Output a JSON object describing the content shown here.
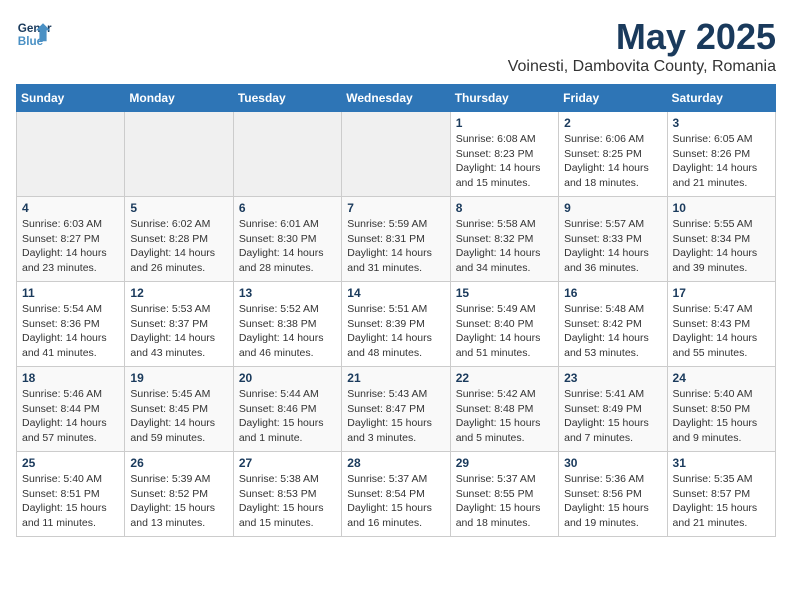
{
  "header": {
    "logo": {
      "line1": "General",
      "line2": "Blue"
    },
    "month_year": "May 2025",
    "location": "Voinesti, Dambovita County, Romania"
  },
  "weekdays": [
    "Sunday",
    "Monday",
    "Tuesday",
    "Wednesday",
    "Thursday",
    "Friday",
    "Saturday"
  ],
  "weeks": [
    [
      {
        "day": "",
        "info": ""
      },
      {
        "day": "",
        "info": ""
      },
      {
        "day": "",
        "info": ""
      },
      {
        "day": "",
        "info": ""
      },
      {
        "day": "1",
        "info": "Sunrise: 6:08 AM\nSunset: 8:23 PM\nDaylight: 14 hours\nand 15 minutes."
      },
      {
        "day": "2",
        "info": "Sunrise: 6:06 AM\nSunset: 8:25 PM\nDaylight: 14 hours\nand 18 minutes."
      },
      {
        "day": "3",
        "info": "Sunrise: 6:05 AM\nSunset: 8:26 PM\nDaylight: 14 hours\nand 21 minutes."
      }
    ],
    [
      {
        "day": "4",
        "info": "Sunrise: 6:03 AM\nSunset: 8:27 PM\nDaylight: 14 hours\nand 23 minutes."
      },
      {
        "day": "5",
        "info": "Sunrise: 6:02 AM\nSunset: 8:28 PM\nDaylight: 14 hours\nand 26 minutes."
      },
      {
        "day": "6",
        "info": "Sunrise: 6:01 AM\nSunset: 8:30 PM\nDaylight: 14 hours\nand 28 minutes."
      },
      {
        "day": "7",
        "info": "Sunrise: 5:59 AM\nSunset: 8:31 PM\nDaylight: 14 hours\nand 31 minutes."
      },
      {
        "day": "8",
        "info": "Sunrise: 5:58 AM\nSunset: 8:32 PM\nDaylight: 14 hours\nand 34 minutes."
      },
      {
        "day": "9",
        "info": "Sunrise: 5:57 AM\nSunset: 8:33 PM\nDaylight: 14 hours\nand 36 minutes."
      },
      {
        "day": "10",
        "info": "Sunrise: 5:55 AM\nSunset: 8:34 PM\nDaylight: 14 hours\nand 39 minutes."
      }
    ],
    [
      {
        "day": "11",
        "info": "Sunrise: 5:54 AM\nSunset: 8:36 PM\nDaylight: 14 hours\nand 41 minutes."
      },
      {
        "day": "12",
        "info": "Sunrise: 5:53 AM\nSunset: 8:37 PM\nDaylight: 14 hours\nand 43 minutes."
      },
      {
        "day": "13",
        "info": "Sunrise: 5:52 AM\nSunset: 8:38 PM\nDaylight: 14 hours\nand 46 minutes."
      },
      {
        "day": "14",
        "info": "Sunrise: 5:51 AM\nSunset: 8:39 PM\nDaylight: 14 hours\nand 48 minutes."
      },
      {
        "day": "15",
        "info": "Sunrise: 5:49 AM\nSunset: 8:40 PM\nDaylight: 14 hours\nand 51 minutes."
      },
      {
        "day": "16",
        "info": "Sunrise: 5:48 AM\nSunset: 8:42 PM\nDaylight: 14 hours\nand 53 minutes."
      },
      {
        "day": "17",
        "info": "Sunrise: 5:47 AM\nSunset: 8:43 PM\nDaylight: 14 hours\nand 55 minutes."
      }
    ],
    [
      {
        "day": "18",
        "info": "Sunrise: 5:46 AM\nSunset: 8:44 PM\nDaylight: 14 hours\nand 57 minutes."
      },
      {
        "day": "19",
        "info": "Sunrise: 5:45 AM\nSunset: 8:45 PM\nDaylight: 14 hours\nand 59 minutes."
      },
      {
        "day": "20",
        "info": "Sunrise: 5:44 AM\nSunset: 8:46 PM\nDaylight: 15 hours\nand 1 minute."
      },
      {
        "day": "21",
        "info": "Sunrise: 5:43 AM\nSunset: 8:47 PM\nDaylight: 15 hours\nand 3 minutes."
      },
      {
        "day": "22",
        "info": "Sunrise: 5:42 AM\nSunset: 8:48 PM\nDaylight: 15 hours\nand 5 minutes."
      },
      {
        "day": "23",
        "info": "Sunrise: 5:41 AM\nSunset: 8:49 PM\nDaylight: 15 hours\nand 7 minutes."
      },
      {
        "day": "24",
        "info": "Sunrise: 5:40 AM\nSunset: 8:50 PM\nDaylight: 15 hours\nand 9 minutes."
      }
    ],
    [
      {
        "day": "25",
        "info": "Sunrise: 5:40 AM\nSunset: 8:51 PM\nDaylight: 15 hours\nand 11 minutes."
      },
      {
        "day": "26",
        "info": "Sunrise: 5:39 AM\nSunset: 8:52 PM\nDaylight: 15 hours\nand 13 minutes."
      },
      {
        "day": "27",
        "info": "Sunrise: 5:38 AM\nSunset: 8:53 PM\nDaylight: 15 hours\nand 15 minutes."
      },
      {
        "day": "28",
        "info": "Sunrise: 5:37 AM\nSunset: 8:54 PM\nDaylight: 15 hours\nand 16 minutes."
      },
      {
        "day": "29",
        "info": "Sunrise: 5:37 AM\nSunset: 8:55 PM\nDaylight: 15 hours\nand 18 minutes."
      },
      {
        "day": "30",
        "info": "Sunrise: 5:36 AM\nSunset: 8:56 PM\nDaylight: 15 hours\nand 19 minutes."
      },
      {
        "day": "31",
        "info": "Sunrise: 5:35 AM\nSunset: 8:57 PM\nDaylight: 15 hours\nand 21 minutes."
      }
    ]
  ]
}
